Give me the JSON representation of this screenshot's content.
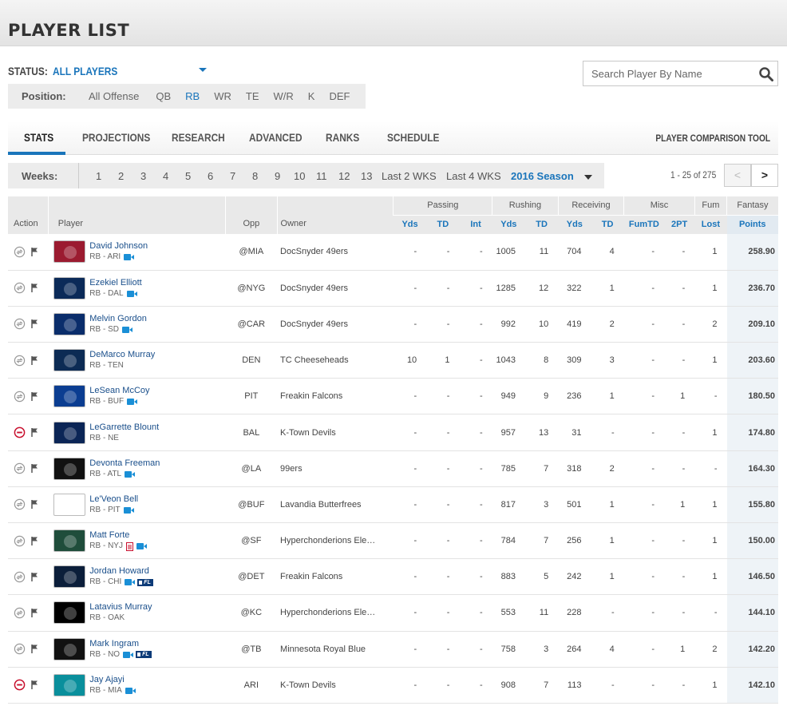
{
  "page": {
    "title": "PLAYER LIST"
  },
  "status": {
    "label": "STATUS:",
    "value": "ALL PLAYERS"
  },
  "positions": {
    "label": "Position:",
    "options": [
      "All Offense",
      "QB",
      "RB",
      "WR",
      "TE",
      "W/R",
      "K",
      "DEF"
    ],
    "active": "RB"
  },
  "search": {
    "placeholder": "Search Player By Name"
  },
  "tabs": [
    "STATS",
    "PROJECTIONS",
    "RESEARCH",
    "ADVANCED",
    "RANKS",
    "SCHEDULE"
  ],
  "active_tab": "STATS",
  "compare_tool": "PLAYER COMPARISON TOOL",
  "weeks": {
    "label": "Weeks:",
    "items": [
      "1",
      "2",
      "3",
      "4",
      "5",
      "6",
      "7",
      "8",
      "9",
      "10",
      "11",
      "12",
      "13",
      "Last 2 WKS",
      "Last 4 WKS"
    ],
    "season": "2016 Season"
  },
  "pager": {
    "range": "1 - 25 of 275",
    "prev": "<",
    "next": ">"
  },
  "table": {
    "groups": {
      "passing": "Passing",
      "rushing": "Rushing",
      "receiving": "Receiving",
      "misc": "Misc",
      "fum": "Fum",
      "fantasy": "Fantasy"
    },
    "cols": {
      "action": "Action",
      "player": "Player",
      "opp": "Opp",
      "owner": "Owner",
      "pass_yds": "Yds",
      "pass_td": "TD",
      "pass_int": "Int",
      "rush_yds": "Yds",
      "rush_td": "TD",
      "rec_yds": "Yds",
      "rec_td": "TD",
      "fumtd": "FumTD",
      "twopt": "2PT",
      "lost": "Lost",
      "points": "Points"
    },
    "rows": [
      {
        "name": "David Johnson",
        "pos": "RB - ARI",
        "team": "ARI",
        "opp": "@MIA",
        "owner": "DocSnyder 49ers",
        "action": "trade",
        "icons": [
          "video"
        ],
        "pass_yds": "-",
        "pass_td": "-",
        "pass_int": "-",
        "rush_yds": "1005",
        "rush_td": "11",
        "rec_yds": "704",
        "rec_td": "4",
        "fumtd": "-",
        "twopt": "-",
        "lost": "1",
        "points": "258.90"
      },
      {
        "name": "Ezekiel Elliott",
        "pos": "RB - DAL",
        "team": "DAL",
        "opp": "@NYG",
        "owner": "DocSnyder 49ers",
        "action": "trade",
        "icons": [
          "video"
        ],
        "pass_yds": "-",
        "pass_td": "-",
        "pass_int": "-",
        "rush_yds": "1285",
        "rush_td": "12",
        "rec_yds": "322",
        "rec_td": "1",
        "fumtd": "-",
        "twopt": "-",
        "lost": "1",
        "points": "236.70"
      },
      {
        "name": "Melvin Gordon",
        "pos": "RB - SD",
        "team": "SD",
        "opp": "@CAR",
        "owner": "DocSnyder 49ers",
        "action": "trade",
        "icons": [
          "video"
        ],
        "pass_yds": "-",
        "pass_td": "-",
        "pass_int": "-",
        "rush_yds": "992",
        "rush_td": "10",
        "rec_yds": "419",
        "rec_td": "2",
        "fumtd": "-",
        "twopt": "-",
        "lost": "2",
        "points": "209.10"
      },
      {
        "name": "DeMarco Murray",
        "pos": "RB - TEN",
        "team": "TEN",
        "opp": "DEN",
        "owner": "TC Cheeseheads",
        "action": "trade",
        "icons": [],
        "pass_yds": "10",
        "pass_td": "1",
        "pass_int": "-",
        "rush_yds": "1043",
        "rush_td": "8",
        "rec_yds": "309",
        "rec_td": "3",
        "fumtd": "-",
        "twopt": "-",
        "lost": "1",
        "points": "203.60"
      },
      {
        "name": "LeSean McCoy",
        "pos": "RB - BUF",
        "team": "BUF",
        "opp": "PIT",
        "owner": "Freakin Falcons",
        "action": "trade",
        "icons": [
          "video"
        ],
        "pass_yds": "-",
        "pass_td": "-",
        "pass_int": "-",
        "rush_yds": "949",
        "rush_td": "9",
        "rec_yds": "236",
        "rec_td": "1",
        "fumtd": "-",
        "twopt": "1",
        "lost": "-",
        "points": "180.50"
      },
      {
        "name": "LeGarrette Blount",
        "pos": "RB - NE",
        "team": "NE",
        "opp": "BAL",
        "owner": "K-Town Devils",
        "action": "drop",
        "icons": [],
        "pass_yds": "-",
        "pass_td": "-",
        "pass_int": "-",
        "rush_yds": "957",
        "rush_td": "13",
        "rec_yds": "31",
        "rec_td": "-",
        "fumtd": "-",
        "twopt": "-",
        "lost": "1",
        "points": "174.80"
      },
      {
        "name": "Devonta Freeman",
        "pos": "RB - ATL",
        "team": "ATL",
        "opp": "@LA",
        "owner": "99ers",
        "action": "trade",
        "icons": [
          "video"
        ],
        "pass_yds": "-",
        "pass_td": "-",
        "pass_int": "-",
        "rush_yds": "785",
        "rush_td": "7",
        "rec_yds": "318",
        "rec_td": "2",
        "fumtd": "-",
        "twopt": "-",
        "lost": "-",
        "points": "164.30"
      },
      {
        "name": "Le'Veon Bell",
        "pos": "RB - PIT",
        "team": "PIT",
        "opp": "@BUF",
        "owner": "Lavandia Butterfrees",
        "action": "trade",
        "icons": [
          "video"
        ],
        "pass_yds": "-",
        "pass_td": "-",
        "pass_int": "-",
        "rush_yds": "817",
        "rush_td": "3",
        "rec_yds": "501",
        "rec_td": "1",
        "fumtd": "-",
        "twopt": "1",
        "lost": "1",
        "points": "155.80"
      },
      {
        "name": "Matt Forte",
        "pos": "RB - NYJ",
        "team": "NYJ",
        "opp": "@SF",
        "owner": "Hyperchonderions Ele…",
        "action": "trade",
        "icons": [
          "note",
          "video"
        ],
        "pass_yds": "-",
        "pass_td": "-",
        "pass_int": "-",
        "rush_yds": "784",
        "rush_td": "7",
        "rec_yds": "256",
        "rec_td": "1",
        "fumtd": "-",
        "twopt": "-",
        "lost": "1",
        "points": "150.00"
      },
      {
        "name": "Jordan Howard",
        "pos": "RB - CHI",
        "team": "CHI",
        "opp": "@DET",
        "owner": "Freakin Falcons",
        "action": "trade",
        "icons": [
          "video",
          "fl"
        ],
        "fl_label": "FL",
        "pass_yds": "-",
        "pass_td": "-",
        "pass_int": "-",
        "rush_yds": "883",
        "rush_td": "5",
        "rec_yds": "242",
        "rec_td": "1",
        "fumtd": "-",
        "twopt": "-",
        "lost": "1",
        "points": "146.50"
      },
      {
        "name": "Latavius Murray",
        "pos": "RB - OAK",
        "team": "OAK",
        "opp": "@KC",
        "owner": "Hyperchonderions Ele…",
        "action": "trade",
        "icons": [],
        "pass_yds": "-",
        "pass_td": "-",
        "pass_int": "-",
        "rush_yds": "553",
        "rush_td": "11",
        "rec_yds": "228",
        "rec_td": "-",
        "fumtd": "-",
        "twopt": "-",
        "lost": "-",
        "points": "144.10"
      },
      {
        "name": "Mark Ingram",
        "pos": "RB - NO",
        "team": "NO",
        "opp": "@TB",
        "owner": "Minnesota Royal Blue",
        "action": "trade",
        "icons": [
          "video",
          "fl"
        ],
        "fl_label": "FL",
        "pass_yds": "-",
        "pass_td": "-",
        "pass_int": "-",
        "rush_yds": "758",
        "rush_td": "3",
        "rec_yds": "264",
        "rec_td": "4",
        "fumtd": "-",
        "twopt": "1",
        "lost": "2",
        "points": "142.20"
      },
      {
        "name": "Jay Ajayi",
        "pos": "RB - MIA",
        "team": "MIA",
        "opp": "ARI",
        "owner": "K-Town Devils",
        "action": "drop",
        "icons": [
          "video"
        ],
        "pass_yds": "-",
        "pass_td": "-",
        "pass_int": "-",
        "rush_yds": "908",
        "rush_td": "7",
        "rec_yds": "113",
        "rec_td": "-",
        "fumtd": "-",
        "twopt": "-",
        "lost": "1",
        "points": "142.10"
      }
    ]
  },
  "team_colors": {
    "ARI": "#9b1b30",
    "DAL": "#0b2a58",
    "SD": "#0a2d6b",
    "TEN": "#0c2b54",
    "BUF": "#0b3d91",
    "NE": "#0b2556",
    "ATL": "#111111",
    "PIT": "#ffffff",
    "NYJ": "#1f4d3b",
    "CHI": "#0b1e3a",
    "OAK": "#000000",
    "NO": "#111111",
    "MIA": "#0a8f9c"
  },
  "colors": {
    "accent": "#1a75bb",
    "link": "#1a4f8b",
    "drop": "#c8102e"
  }
}
